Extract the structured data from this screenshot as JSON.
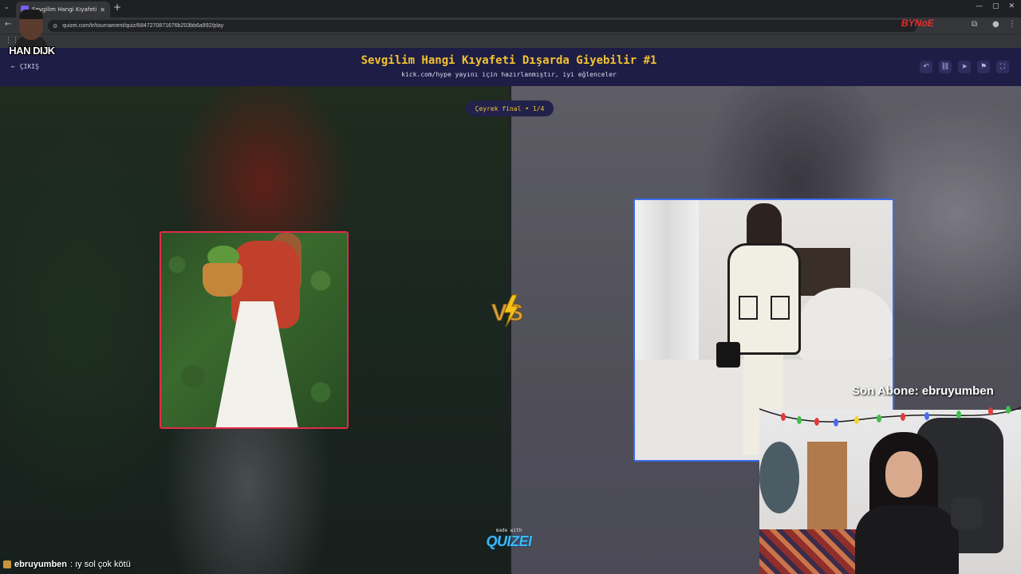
{
  "browser": {
    "tab_title": "Sevgilim Hangi Kıyafeti Dışarda...",
    "url": "quizei.com/tr/tournament/quiz/6847270871676b203bb6a992/play"
  },
  "overlay_brand": "BYNoE",
  "streamer_logo": {
    "name": "HAN DIJK"
  },
  "quiz": {
    "exit_label": "ÇIKIŞ",
    "title": "Sevgilim Hangi Kıyafeti Dışarda Giyebilir #1",
    "subtitle": "kick.com/hype yayını için hazırlanmıştır, iyi eğlenceler",
    "round": "Çeyrek final • 1/4",
    "controls": [
      "undo-icon",
      "link-icon",
      "send-icon",
      "flag-icon",
      "fullscreen-icon"
    ]
  },
  "options": {
    "left": {
      "description": "red blouse with white maxi skirt",
      "accent": "#e32b4a"
    },
    "right": {
      "description": "cream jacket with black trim and cream pants",
      "accent": "#3a6cf0"
    }
  },
  "vs_label": "VS",
  "made_with": {
    "label": "made with",
    "brand": "QUIZEI"
  },
  "stream": {
    "latest_sub_label": "Son Abone: ebruyumben"
  },
  "chat": {
    "user": "ebruyumben",
    "message": ": ıy sol çok kötü"
  }
}
